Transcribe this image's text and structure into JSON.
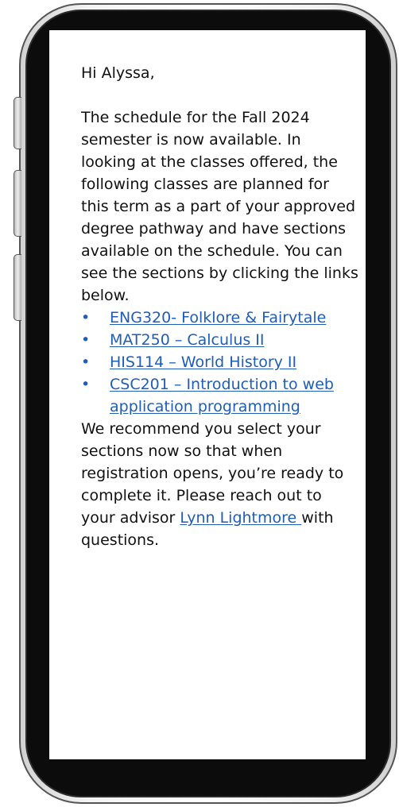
{
  "email": {
    "greeting": "Hi Alyssa,",
    "intro": "The schedule for the Fall 2024 semester is now available. In looking at the classes offered, the following classes are planned for this term as a part of your approved degree pathway and have sections available on the schedule. You can see the sections by clicking the links below.",
    "courses": [
      {
        "label": "ENG320- Folklore & Fairytale"
      },
      {
        "label": "MAT250 – Calculus II"
      },
      {
        "label": "HIS114 – World History II"
      },
      {
        "label": "CSC201 – Introduction to web application programming"
      }
    ],
    "bullet": "•",
    "closing_before": "We recommend you select your sections now so that when registration opens, you’re ready to complete it. Please reach out to your advisor ",
    "advisor_name": "Lynn Lightmore ",
    "closing_after": "with questions."
  },
  "colors": {
    "link": "#1f5dbb",
    "text": "#111111",
    "phone_body": "#0c0c0c"
  }
}
